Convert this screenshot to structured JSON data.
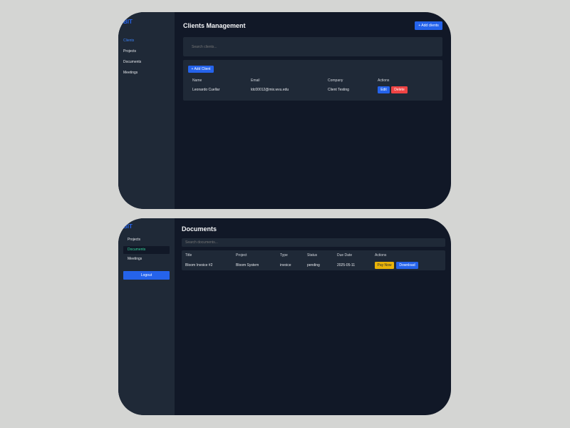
{
  "clients_screen": {
    "logo": "BIT",
    "nav": [
      "Clients",
      "Projects",
      "Documents",
      "Meetings"
    ],
    "title": "Clients Management",
    "add_clients_label": "+ Add clients",
    "search_placeholder": "Search clients...",
    "add_client_label": "+ Add Client",
    "columns": [
      "Name",
      "Email",
      "Company",
      "Actions"
    ],
    "rows": [
      {
        "name": "Leonardo Cuellar",
        "email": "ldc00012@mix.wvu.edu",
        "company": "Client Testing",
        "edit": "Edit",
        "delete": "Delete"
      }
    ]
  },
  "documents_screen": {
    "logo": "BIT",
    "nav": [
      "Projects",
      "Documents",
      "Meetings"
    ],
    "logout_label": "Logout",
    "title": "Documents",
    "search_placeholder": "Search documents...",
    "columns": [
      "Title",
      "Project",
      "Type",
      "Status",
      "Due Date",
      "Actions"
    ],
    "rows": [
      {
        "title": "Bloom Invoice #2",
        "project": "Bloom System",
        "type": "invoice",
        "status": "pending",
        "due_date": "2025-05-11",
        "pay": "Pay Now",
        "download": "Download"
      }
    ]
  },
  "colors": {
    "background": "#d4d5d3",
    "panel": "#111827",
    "sidebar": "#1f2937",
    "accent": "#2563eb",
    "danger": "#ef4444",
    "warning": "#eab308",
    "active_nav": "#34d399"
  }
}
